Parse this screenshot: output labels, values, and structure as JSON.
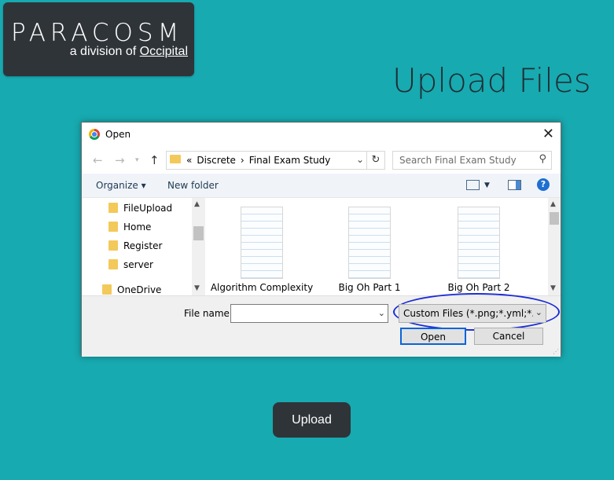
{
  "brand": {
    "wordmark": "PARACOSM",
    "sub_prefix": "a division of ",
    "sub_link": "Occipital"
  },
  "page": {
    "title": "Upload Files",
    "upload_button": "Upload"
  },
  "dialog": {
    "title": "Open",
    "breadcrumb": [
      "«",
      "Discrete",
      "›",
      "Final Exam Study"
    ],
    "search_placeholder": "Search Final Exam Study",
    "toolbar": {
      "organize": "Organize ▾",
      "new_folder": "New folder"
    },
    "tree": [
      "FileUpload",
      "Home",
      "Register",
      "server",
      "OneDrive"
    ],
    "files": [
      "Algorithm Complexity",
      "Big Oh Part 1",
      "Big Oh Part 2"
    ],
    "file_name_label": "File name:",
    "file_name_value": "",
    "file_type": "Custom Files (*.png;*.yml;*.ros)",
    "open_button": "Open",
    "cancel_button": "Cancel"
  },
  "icons": [
    "chrome-icon",
    "close-icon",
    "back-arrow-icon",
    "forward-arrow-icon",
    "up-arrow-icon",
    "folder-icon",
    "refresh-icon",
    "search-icon",
    "view-icon",
    "preview-pane-icon",
    "help-icon"
  ]
}
